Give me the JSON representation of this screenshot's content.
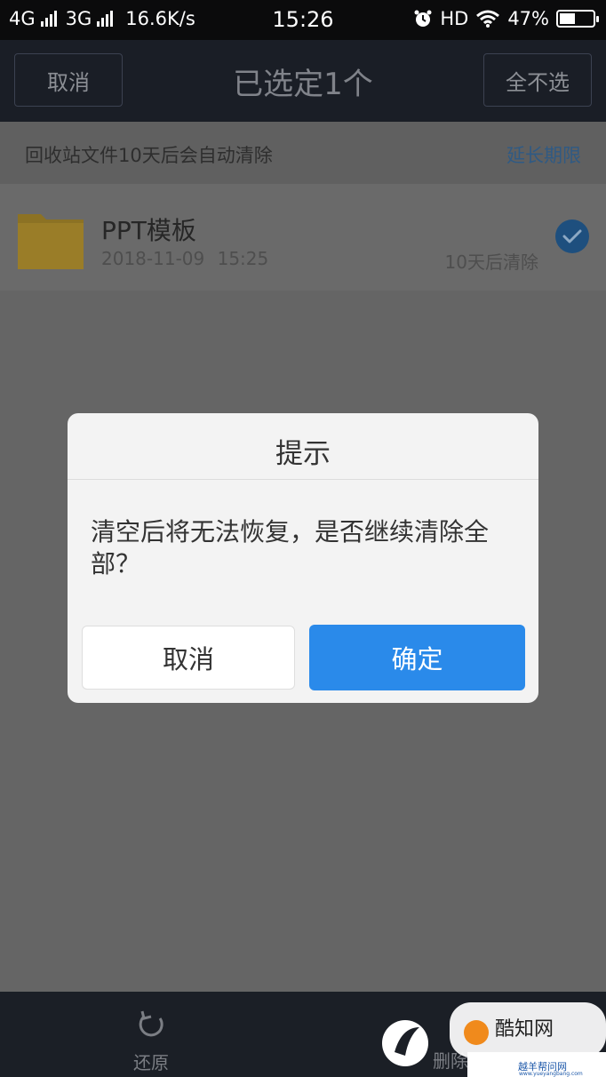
{
  "status_bar": {
    "network1": "4G",
    "network2": "3G",
    "speed": "16.6K/s",
    "time": "15:26",
    "hd": "HD",
    "battery_text": "47%",
    "battery_level": 0.47
  },
  "header": {
    "cancel_label": "取消",
    "title": "已选定1个",
    "deselect_all_label": "全不选"
  },
  "info": {
    "message": "回收站文件10天后会自动清除",
    "extend_label": "延长期限"
  },
  "file": {
    "name": "PPT模板",
    "date": "2018-11-09 15:25",
    "expire": "10天后清除",
    "selected": true
  },
  "dialog": {
    "title": "提示",
    "message": "清空后将无法恢复，是否继续清除全部？",
    "cancel_label": "取消",
    "confirm_label": "确定"
  },
  "bottom": {
    "restore_label": "还原",
    "delete_label": "删除"
  },
  "watermark": {
    "text": "酷知网",
    "url": "www.yueyangbang.com",
    "subtext": "越羊帮问网"
  },
  "colors": {
    "accent": "#2a8aea",
    "title_bar": "#1a1e26",
    "status_bar": "#0b0b0c",
    "folder": "#b8962e",
    "dim_overlay": "#656565"
  },
  "icons": {
    "signal": "signal-bars-icon",
    "alarm": "alarm-clock-icon",
    "wifi": "wifi-icon",
    "battery": "battery-icon",
    "folder": "folder-icon",
    "check": "check-circle-icon",
    "restore": "restore-icon"
  }
}
